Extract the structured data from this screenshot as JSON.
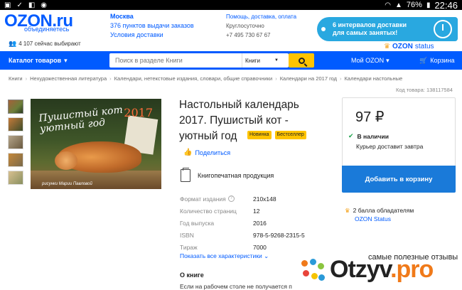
{
  "statusbar": {
    "battery": "76%",
    "time": "22:46"
  },
  "header": {
    "logo": "OZON.ru",
    "logo_sub": "объединяетесь",
    "watchers": "4 107 сейчас выбирают",
    "city": {
      "name": "Москва",
      "pickup": "376 пунктов выдачи заказов",
      "delivery": "Условия доставки"
    },
    "help": {
      "link": "Помощь, доставка, оплата",
      "hours": "Круглосуточно",
      "phone": "+7 495 730 67 67"
    },
    "promo": {
      "line1": "6 интервалов доставки",
      "line2": "для самых занятых!"
    },
    "status_label": "OZON",
    "status_suffix": "status"
  },
  "navbar": {
    "catalog": "Каталог товаров",
    "search_placeholder": "Поиск в разделе Книги",
    "search_scope": "Книги",
    "my_ozon": "Мой OZON",
    "cart": "Корзина"
  },
  "breadcrumbs": [
    "Книги",
    "Нехудожественная литература",
    "Календари, нетекстовые издания, словари, общие справочники",
    "Календари на 2017 год",
    "Календари настольные"
  ],
  "product_code": "Код товара: 138117584",
  "product": {
    "title": "Настольный календарь 2017. Пушистый кот - уютный год",
    "badge_new": "Новинка",
    "badge_best": "Бестселлер",
    "share": "Поделиться",
    "type": "Книгопечатная продукция",
    "cover_title": "Пушистый кот уютный год",
    "cover_year": "2017",
    "cover_author": "рисунки Марии Павловой",
    "specs": [
      {
        "key": "Формат издания",
        "value": "210x148"
      },
      {
        "key": "Количество страниц",
        "value": "12"
      },
      {
        "key": "Год выпуска",
        "value": "2016"
      },
      {
        "key": "ISBN",
        "value": "978-5-9268-2315-5"
      },
      {
        "key": "Тираж",
        "value": "7000"
      }
    ],
    "more_specs": "Показать все характеристики",
    "about_title": "О книге",
    "about_text": "Если на рабочем столе не получается п"
  },
  "buybox": {
    "price": "97 ₽",
    "stock": "В наличии",
    "delivery": "Курьер доставит завтра",
    "buy_button": "Добавить в корзину",
    "bonus": "2 балла обладателям",
    "bonus_link": "OZON Status"
  },
  "watermark": {
    "caption": "самые полезные отзывы",
    "name_main": "Otzyv",
    "name_tld": ".pro"
  },
  "colors": {
    "brand": "#005bff",
    "accent": "#ffc400",
    "buy": "#1a7ad9"
  }
}
